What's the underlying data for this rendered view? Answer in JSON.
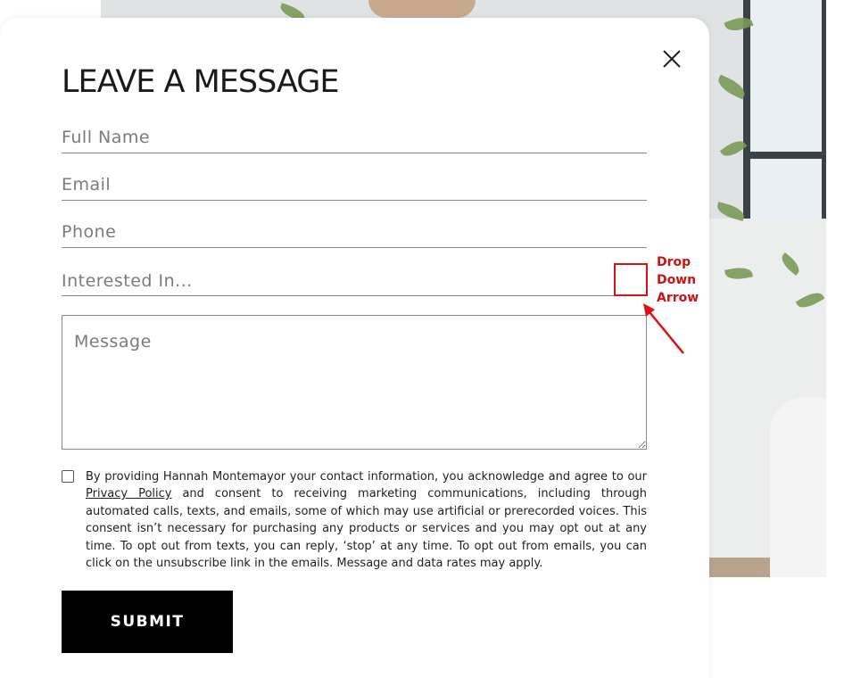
{
  "form": {
    "title": "LEAVE A MESSAGE",
    "fields": {
      "full_name_placeholder": "Full Name",
      "email_placeholder": "Email",
      "phone_placeholder": "Phone",
      "interested_in_label": "Interested In...",
      "message_placeholder": "Message"
    },
    "consent": {
      "text_before_link": "By providing Hannah Montemayor your contact information, you acknowledge and agree to our ",
      "link_text": "Privacy Policy",
      "text_after_link": " and consent to receiving marketing communications, including through automated calls, texts, and emails, some of which may use artificial or prerecorded voices. This consent isn’t necessary for purchasing any products or services and you may opt out at any time. To opt out from texts, you can reply, ‘stop’ at any time. To opt out from emails, you can click on the unsubscribe link in the emails. Message and data rates may apply."
    },
    "submit_label": "SUBMIT"
  },
  "annotation": {
    "line1": "Drop",
    "line2": "Down",
    "line3": "Arrow",
    "color": "#cc1111"
  },
  "icons": {
    "close": "close-icon",
    "resize": "resize-grip-icon"
  }
}
